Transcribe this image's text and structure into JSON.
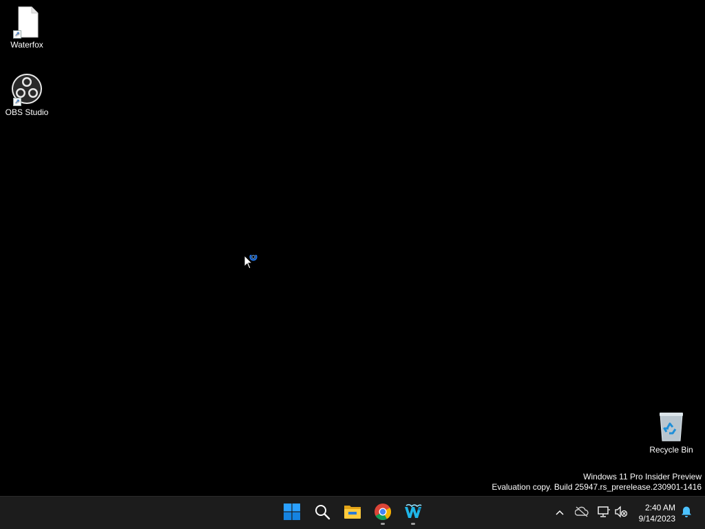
{
  "desktop": {
    "icons": [
      {
        "label": "Waterfox",
        "icon": "file-shortcut-icon"
      },
      {
        "label": "OBS Studio",
        "icon": "obs-studio-icon"
      },
      {
        "label": "Recycle Bin",
        "icon": "recycle-bin-icon"
      }
    ],
    "watermark": {
      "line1": "Windows 11 Pro Insider Preview",
      "line2": "Evaluation copy. Build 25947.rs_prerelease.230901-1416"
    },
    "cursor": "busy-pointer-icon"
  },
  "taskbar": {
    "apps": [
      {
        "icon": "windows-start-icon",
        "running": false
      },
      {
        "icon": "search-icon",
        "running": false
      },
      {
        "icon": "file-explorer-icon",
        "running": false
      },
      {
        "icon": "chrome-icon",
        "running": true
      },
      {
        "icon": "waterfox-icon",
        "running": true
      }
    ],
    "tray": [
      {
        "icon": "chevron-up-icon"
      },
      {
        "icon": "onedrive-offline-icon"
      },
      {
        "icon": "network-icon"
      },
      {
        "icon": "volume-muted-icon"
      },
      {
        "icon": "notification-bell-icon"
      }
    ],
    "clock": {
      "time": "2:40 AM",
      "date": "9/14/2023"
    }
  },
  "colors": {
    "desktop_bg": "#000000",
    "taskbar_bg": "#1c1c1c",
    "accent": "#0078d4",
    "notification": "#4cc2ff"
  }
}
